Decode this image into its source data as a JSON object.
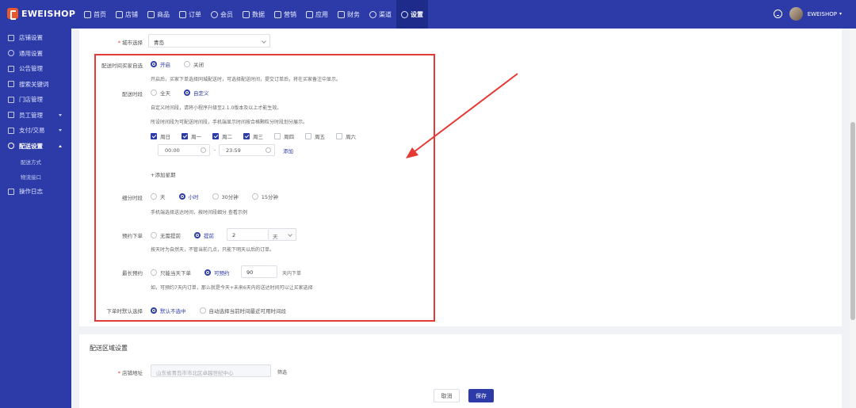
{
  "brand": {
    "name": "EWEISHOP"
  },
  "nav": [
    {
      "label": "首页",
      "icon": "home-icon"
    },
    {
      "label": "店铺",
      "icon": "store-icon"
    },
    {
      "label": "商品",
      "icon": "goods-icon"
    },
    {
      "label": "订单",
      "icon": "order-icon"
    },
    {
      "label": "会员",
      "icon": "member-icon"
    },
    {
      "label": "数据",
      "icon": "chart-icon"
    },
    {
      "label": "营销",
      "icon": "tag-icon"
    },
    {
      "label": "应用",
      "icon": "app-icon"
    },
    {
      "label": "财务",
      "icon": "finance-icon"
    },
    {
      "label": "渠道",
      "icon": "channel-icon"
    },
    {
      "label": "设置",
      "icon": "gear-icon",
      "active": true
    }
  ],
  "user": {
    "name": "EWEISHOP"
  },
  "sidebar": {
    "items": [
      {
        "label": "店铺设置"
      },
      {
        "label": "通用设置"
      },
      {
        "label": "公告管理"
      },
      {
        "label": "搜索关键词"
      },
      {
        "label": "门店管理"
      },
      {
        "label": "员工管理"
      },
      {
        "label": "支付/交易"
      },
      {
        "label": "配送设置"
      },
      {
        "label": "操作日志"
      }
    ],
    "sub": [
      {
        "label": "配送方式"
      },
      {
        "label": "物流接口"
      }
    ]
  },
  "form": {
    "city": {
      "label": "城市选择",
      "value": "青岛"
    },
    "buyer_choose": {
      "label": "配送时间买家自选",
      "options": [
        "开启",
        "关闭"
      ],
      "hint": "开启后，买家下单选择同城配送时，可选择配送时间，提交订单后，将在买家备注中显示。"
    },
    "period": {
      "label": "配送时段",
      "options": [
        "全天",
        "自定义"
      ],
      "hint1": "自定义时间段，请将小程序升级至2.1.0版本及以上才能生效。",
      "hint2": "所设时间段为可配送时间段，手机端显示时间按合格颗粒分时段划分展示。",
      "days": [
        "周日",
        "周一",
        "周二",
        "周三",
        "周四",
        "周五",
        "周六"
      ],
      "start": "00:00",
      "sep": "-",
      "end": "23:59",
      "add": "添加",
      "add_period": "+添加星期"
    },
    "granularity": {
      "label": "细分时段",
      "options": [
        "天",
        "小时",
        "30分钟",
        "15分钟"
      ],
      "hint": "手机端选择送达时间，按时间段细分 查看示例"
    },
    "preorder": {
      "label": "预约下单",
      "options": [
        "无需提前",
        "提前"
      ],
      "value": "2",
      "unit": "天",
      "hint": "按天时为自然天，不管当前几点，只能下明天以后的订单。"
    },
    "longest": {
      "label": "最长预约",
      "options": [
        "只能当天下单",
        "可预约"
      ],
      "value": "90",
      "unit": "天内下单",
      "hint": "如，可预约7天内订单，那么就是今天+未来6天内的送达时间可以让买家选择"
    },
    "default_select": {
      "label": "下单时默认选择",
      "options": [
        "默认不选中",
        "自动选择当前时间最近可用时间段"
      ]
    }
  },
  "area": {
    "title": "配送区域设置",
    "address_label": "店铺地址",
    "address_placeholder": "山东省青岛市市北区卓越世纪中心",
    "filter": "筛选"
  },
  "actions": {
    "cancel": "取消",
    "save": "保存"
  },
  "colors": {
    "primary": "#2d3ba8",
    "annotation": "#e53935"
  }
}
